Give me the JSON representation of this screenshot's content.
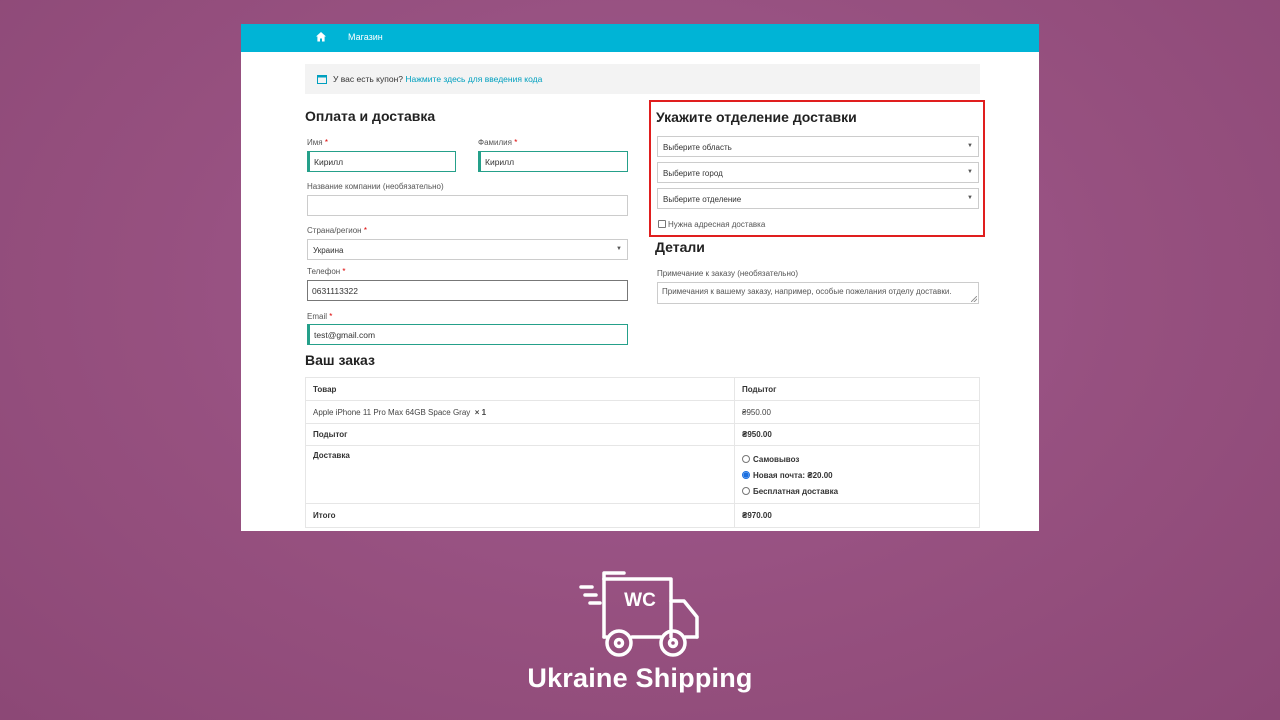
{
  "header": {
    "shop_link": "Магазин"
  },
  "coupon": {
    "prompt": "У вас есть купон?",
    "link": "Нажмите здесь для введения кода"
  },
  "billing": {
    "title": "Оплата и доставка",
    "first_name_label": "Имя",
    "first_name_value": "Кирилл",
    "last_name_label": "Фамилия",
    "last_name_value": "Кирилл",
    "company_label": "Название компании (необязательно)",
    "company_value": "",
    "country_label": "Страна/регион",
    "country_value": "Украина",
    "phone_label": "Телефон",
    "phone_value": "0631113322",
    "email_label": "Email",
    "email_value": "test@gmail.com",
    "required_mark": "*"
  },
  "delivery": {
    "title": "Укажите отделение доставки",
    "region_placeholder": "Выберите область",
    "city_placeholder": "Выберите город",
    "branch_placeholder": "Выберите отделение",
    "address_checkbox": "Нужна адресная доставка",
    "highlight_color": "#e01e1e"
  },
  "details": {
    "title": "Детали",
    "note_label": "Примечание к заказу (необязательно)",
    "note_placeholder": "Примечания к вашему заказу, например, особые пожелания отделу доставки."
  },
  "order": {
    "title": "Ваш заказ",
    "col_product": "Товар",
    "col_subtotal": "Подытог",
    "item_name": "Apple iPhone 11 Pro Max 64GB Space Gray",
    "item_qty": "× 1",
    "item_price": "₴950.00",
    "subtotal_label": "Подытог",
    "subtotal_value": "₴950.00",
    "shipping_label": "Доставка",
    "shipping_options": [
      "Самовывоз",
      "Новая почта: ₴20.00",
      "Бесплатная доставка"
    ],
    "shipping_selected": 1,
    "total_label": "Итого",
    "total_value": "₴970.00"
  },
  "branding": {
    "logo_text": "WC",
    "product_name": "Ukraine Shipping"
  },
  "colors": {
    "background": "#9a527f",
    "topbar": "#00b4d6",
    "link": "#00a0bf",
    "focus_border": "#25a08a"
  }
}
